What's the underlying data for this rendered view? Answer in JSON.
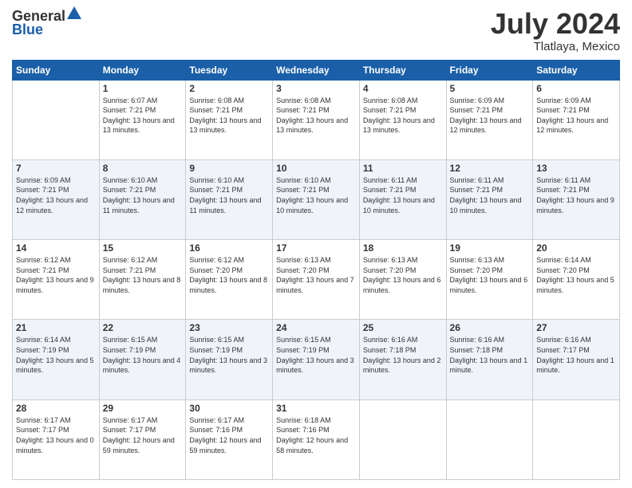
{
  "logo": {
    "general": "General",
    "blue": "Blue"
  },
  "header": {
    "month": "July 2024",
    "location": "Tlatlaya, Mexico"
  },
  "weekdays": [
    "Sunday",
    "Monday",
    "Tuesday",
    "Wednesday",
    "Thursday",
    "Friday",
    "Saturday"
  ],
  "weeks": [
    [
      {
        "day": "",
        "sunrise": "",
        "sunset": "",
        "daylight": ""
      },
      {
        "day": "1",
        "sunrise": "Sunrise: 6:07 AM",
        "sunset": "Sunset: 7:21 PM",
        "daylight": "Daylight: 13 hours and 13 minutes."
      },
      {
        "day": "2",
        "sunrise": "Sunrise: 6:08 AM",
        "sunset": "Sunset: 7:21 PM",
        "daylight": "Daylight: 13 hours and 13 minutes."
      },
      {
        "day": "3",
        "sunrise": "Sunrise: 6:08 AM",
        "sunset": "Sunset: 7:21 PM",
        "daylight": "Daylight: 13 hours and 13 minutes."
      },
      {
        "day": "4",
        "sunrise": "Sunrise: 6:08 AM",
        "sunset": "Sunset: 7:21 PM",
        "daylight": "Daylight: 13 hours and 13 minutes."
      },
      {
        "day": "5",
        "sunrise": "Sunrise: 6:09 AM",
        "sunset": "Sunset: 7:21 PM",
        "daylight": "Daylight: 13 hours and 12 minutes."
      },
      {
        "day": "6",
        "sunrise": "Sunrise: 6:09 AM",
        "sunset": "Sunset: 7:21 PM",
        "daylight": "Daylight: 13 hours and 12 minutes."
      }
    ],
    [
      {
        "day": "7",
        "sunrise": "Sunrise: 6:09 AM",
        "sunset": "Sunset: 7:21 PM",
        "daylight": "Daylight: 13 hours and 12 minutes."
      },
      {
        "day": "8",
        "sunrise": "Sunrise: 6:10 AM",
        "sunset": "Sunset: 7:21 PM",
        "daylight": "Daylight: 13 hours and 11 minutes."
      },
      {
        "day": "9",
        "sunrise": "Sunrise: 6:10 AM",
        "sunset": "Sunset: 7:21 PM",
        "daylight": "Daylight: 13 hours and 11 minutes."
      },
      {
        "day": "10",
        "sunrise": "Sunrise: 6:10 AM",
        "sunset": "Sunset: 7:21 PM",
        "daylight": "Daylight: 13 hours and 10 minutes."
      },
      {
        "day": "11",
        "sunrise": "Sunrise: 6:11 AM",
        "sunset": "Sunset: 7:21 PM",
        "daylight": "Daylight: 13 hours and 10 minutes."
      },
      {
        "day": "12",
        "sunrise": "Sunrise: 6:11 AM",
        "sunset": "Sunset: 7:21 PM",
        "daylight": "Daylight: 13 hours and 10 minutes."
      },
      {
        "day": "13",
        "sunrise": "Sunrise: 6:11 AM",
        "sunset": "Sunset: 7:21 PM",
        "daylight": "Daylight: 13 hours and 9 minutes."
      }
    ],
    [
      {
        "day": "14",
        "sunrise": "Sunrise: 6:12 AM",
        "sunset": "Sunset: 7:21 PM",
        "daylight": "Daylight: 13 hours and 9 minutes."
      },
      {
        "day": "15",
        "sunrise": "Sunrise: 6:12 AM",
        "sunset": "Sunset: 7:21 PM",
        "daylight": "Daylight: 13 hours and 8 minutes."
      },
      {
        "day": "16",
        "sunrise": "Sunrise: 6:12 AM",
        "sunset": "Sunset: 7:20 PM",
        "daylight": "Daylight: 13 hours and 8 minutes."
      },
      {
        "day": "17",
        "sunrise": "Sunrise: 6:13 AM",
        "sunset": "Sunset: 7:20 PM",
        "daylight": "Daylight: 13 hours and 7 minutes."
      },
      {
        "day": "18",
        "sunrise": "Sunrise: 6:13 AM",
        "sunset": "Sunset: 7:20 PM",
        "daylight": "Daylight: 13 hours and 6 minutes."
      },
      {
        "day": "19",
        "sunrise": "Sunrise: 6:13 AM",
        "sunset": "Sunset: 7:20 PM",
        "daylight": "Daylight: 13 hours and 6 minutes."
      },
      {
        "day": "20",
        "sunrise": "Sunrise: 6:14 AM",
        "sunset": "Sunset: 7:20 PM",
        "daylight": "Daylight: 13 hours and 5 minutes."
      }
    ],
    [
      {
        "day": "21",
        "sunrise": "Sunrise: 6:14 AM",
        "sunset": "Sunset: 7:19 PM",
        "daylight": "Daylight: 13 hours and 5 minutes."
      },
      {
        "day": "22",
        "sunrise": "Sunrise: 6:15 AM",
        "sunset": "Sunset: 7:19 PM",
        "daylight": "Daylight: 13 hours and 4 minutes."
      },
      {
        "day": "23",
        "sunrise": "Sunrise: 6:15 AM",
        "sunset": "Sunset: 7:19 PM",
        "daylight": "Daylight: 13 hours and 3 minutes."
      },
      {
        "day": "24",
        "sunrise": "Sunrise: 6:15 AM",
        "sunset": "Sunset: 7:19 PM",
        "daylight": "Daylight: 13 hours and 3 minutes."
      },
      {
        "day": "25",
        "sunrise": "Sunrise: 6:16 AM",
        "sunset": "Sunset: 7:18 PM",
        "daylight": "Daylight: 13 hours and 2 minutes."
      },
      {
        "day": "26",
        "sunrise": "Sunrise: 6:16 AM",
        "sunset": "Sunset: 7:18 PM",
        "daylight": "Daylight: 13 hours and 1 minute."
      },
      {
        "day": "27",
        "sunrise": "Sunrise: 6:16 AM",
        "sunset": "Sunset: 7:17 PM",
        "daylight": "Daylight: 13 hours and 1 minute."
      }
    ],
    [
      {
        "day": "28",
        "sunrise": "Sunrise: 6:17 AM",
        "sunset": "Sunset: 7:17 PM",
        "daylight": "Daylight: 13 hours and 0 minutes."
      },
      {
        "day": "29",
        "sunrise": "Sunrise: 6:17 AM",
        "sunset": "Sunset: 7:17 PM",
        "daylight": "Daylight: 12 hours and 59 minutes."
      },
      {
        "day": "30",
        "sunrise": "Sunrise: 6:17 AM",
        "sunset": "Sunset: 7:16 PM",
        "daylight": "Daylight: 12 hours and 59 minutes."
      },
      {
        "day": "31",
        "sunrise": "Sunrise: 6:18 AM",
        "sunset": "Sunset: 7:16 PM",
        "daylight": "Daylight: 12 hours and 58 minutes."
      },
      {
        "day": "",
        "sunrise": "",
        "sunset": "",
        "daylight": ""
      },
      {
        "day": "",
        "sunrise": "",
        "sunset": "",
        "daylight": ""
      },
      {
        "day": "",
        "sunrise": "",
        "sunset": "",
        "daylight": ""
      }
    ]
  ]
}
